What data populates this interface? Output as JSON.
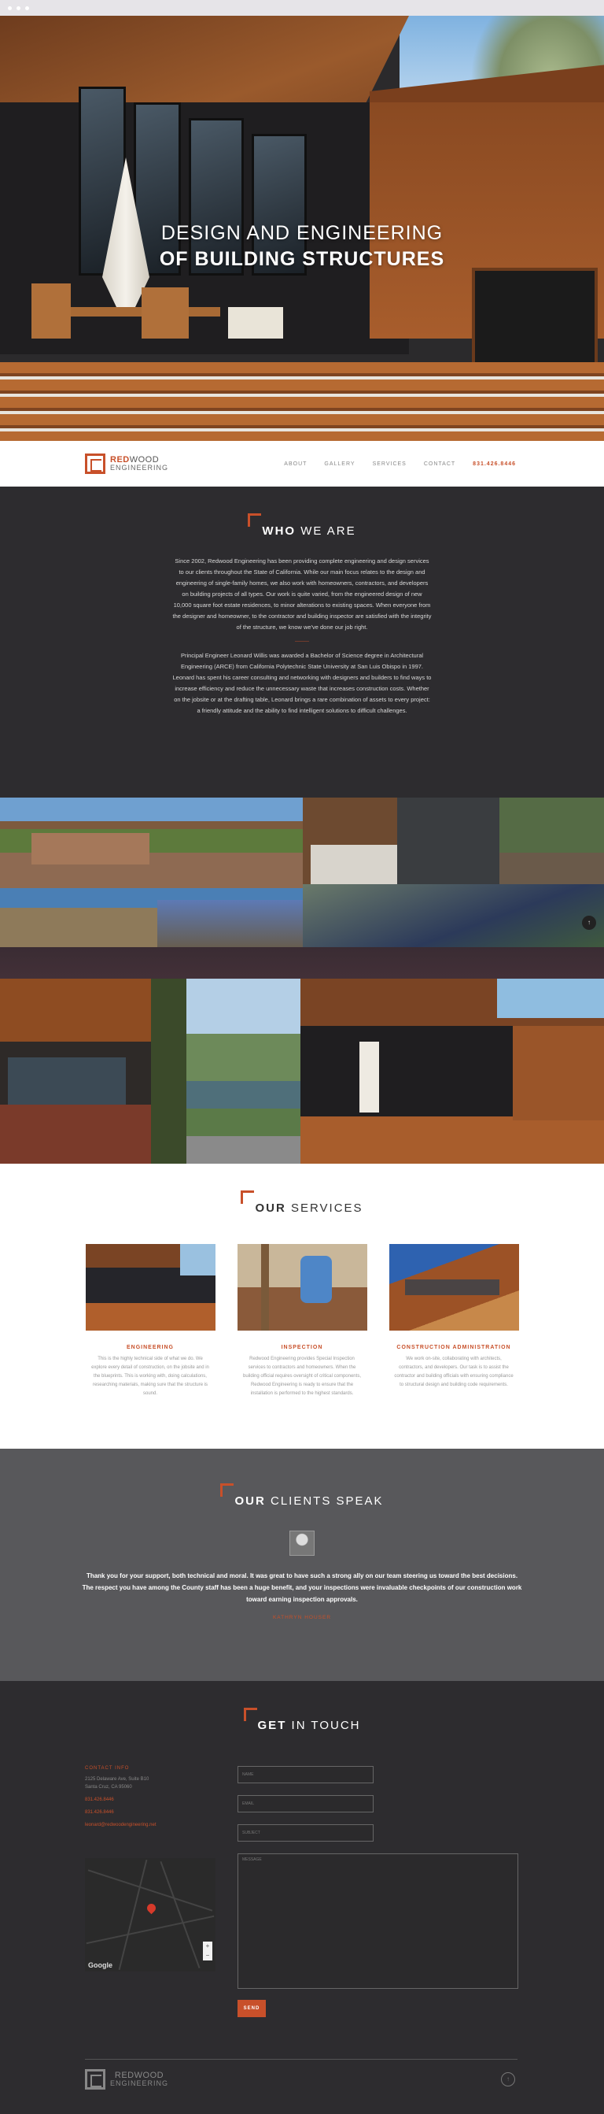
{
  "hero": {
    "line1": "DESIGN AND ENGINEERING",
    "line2": "OF BUILDING STRUCTURES"
  },
  "nav": {
    "logo_word1": "RED",
    "logo_word2": "WOOD",
    "logo_sub": "ENGINEERING",
    "items": [
      "ABOUT",
      "GALLERY",
      "SERVICES",
      "CONTACT"
    ],
    "phone": "831.426.8446"
  },
  "who": {
    "title_bold": "WHO",
    "title_rest": " WE ARE",
    "para1": "Since 2002, Redwood Engineering has been providing complete engineering and design services to our clients throughout the State of California. While our main focus relates to the design and engineering of single-family homes, we also work with homeowners, contractors, and developers on building projects of all types. Our work is quite varied, from the engineered design of new 10,000 square foot estate residences, to minor alterations to existing spaces. When everyone from the designer and homeowner, to the contractor and building inspector are satisfied with the integrity of the structure, we know we've done our job right.",
    "divider": "———",
    "para2": "Principal Engineer Leonard Willis was awarded a Bachelor of Science degree in Architectural Engineering (ARCE) from California Polytechnic State University at San Luis Obispo in 1997. Leonard has spent his career consulting and networking with designers and builders to find ways to increase efficiency and reduce the unnecessary waste that increases construction costs. Whether on the jobsite or at the drafting table, Leonard brings a rare combination of assets to every project: a friendly attitude and the ability to find intelligent solutions to difficult challenges."
  },
  "services": {
    "title_bold": "OUR",
    "title_rest": " SERVICES",
    "cards": [
      {
        "title": "ENGINEERING",
        "text": "This is the highly technical side of what we do. We explore every detail of construction, on the jobsite and in the blueprints. This is working with, doing calculations, researching materials, making sure that the structure is sound."
      },
      {
        "title": "INSPECTION",
        "text": "Redwood Engineering provides Special Inspection services to contractors and homeowners. When the building official requires oversight of critical components, Redwood Engineering is ready to ensure that the installation is performed to the highest standards."
      },
      {
        "title": "CONSTRUCTION ADMINISTRATION",
        "text": "We work on-site, collaborating with architects, contractors, and developers. Our task is to assist the contractor and building officials with ensuring compliance to structural design and building code requirements."
      }
    ]
  },
  "clients": {
    "title_bold": "OUR",
    "title_rest": " CLIENTS SPEAK",
    "quote": "Thank you for your support, both technical and moral. It was great to have such a strong ally on our team steering us toward the best decisions. The respect you have among the County staff has been a huge benefit, and your inspections were invaluable checkpoints of our construction work toward earning inspection approvals.",
    "author": "KATHRYN HOUSER"
  },
  "contact": {
    "title_bold": "GET",
    "title_rest": " IN TOUCH",
    "info_label": "CONTACT INFO",
    "address1": "2125 Delaware Ave, Suite B10",
    "address2": "Santa Cruz, CA 95060",
    "phone": "831.426.8446",
    "fax": "831.426.8446",
    "email": "leonard@redwoodengineering.net",
    "name_ph": "NAME",
    "email_ph": "EMAIL",
    "subject_ph": "SUBJECT",
    "message_ph": "MESSAGE",
    "send": "SEND",
    "map_brand": "Google",
    "zoom_in": "+",
    "zoom_out": "−",
    "up_arrow": "↑"
  },
  "gallery": {
    "arrow": "↑"
  }
}
